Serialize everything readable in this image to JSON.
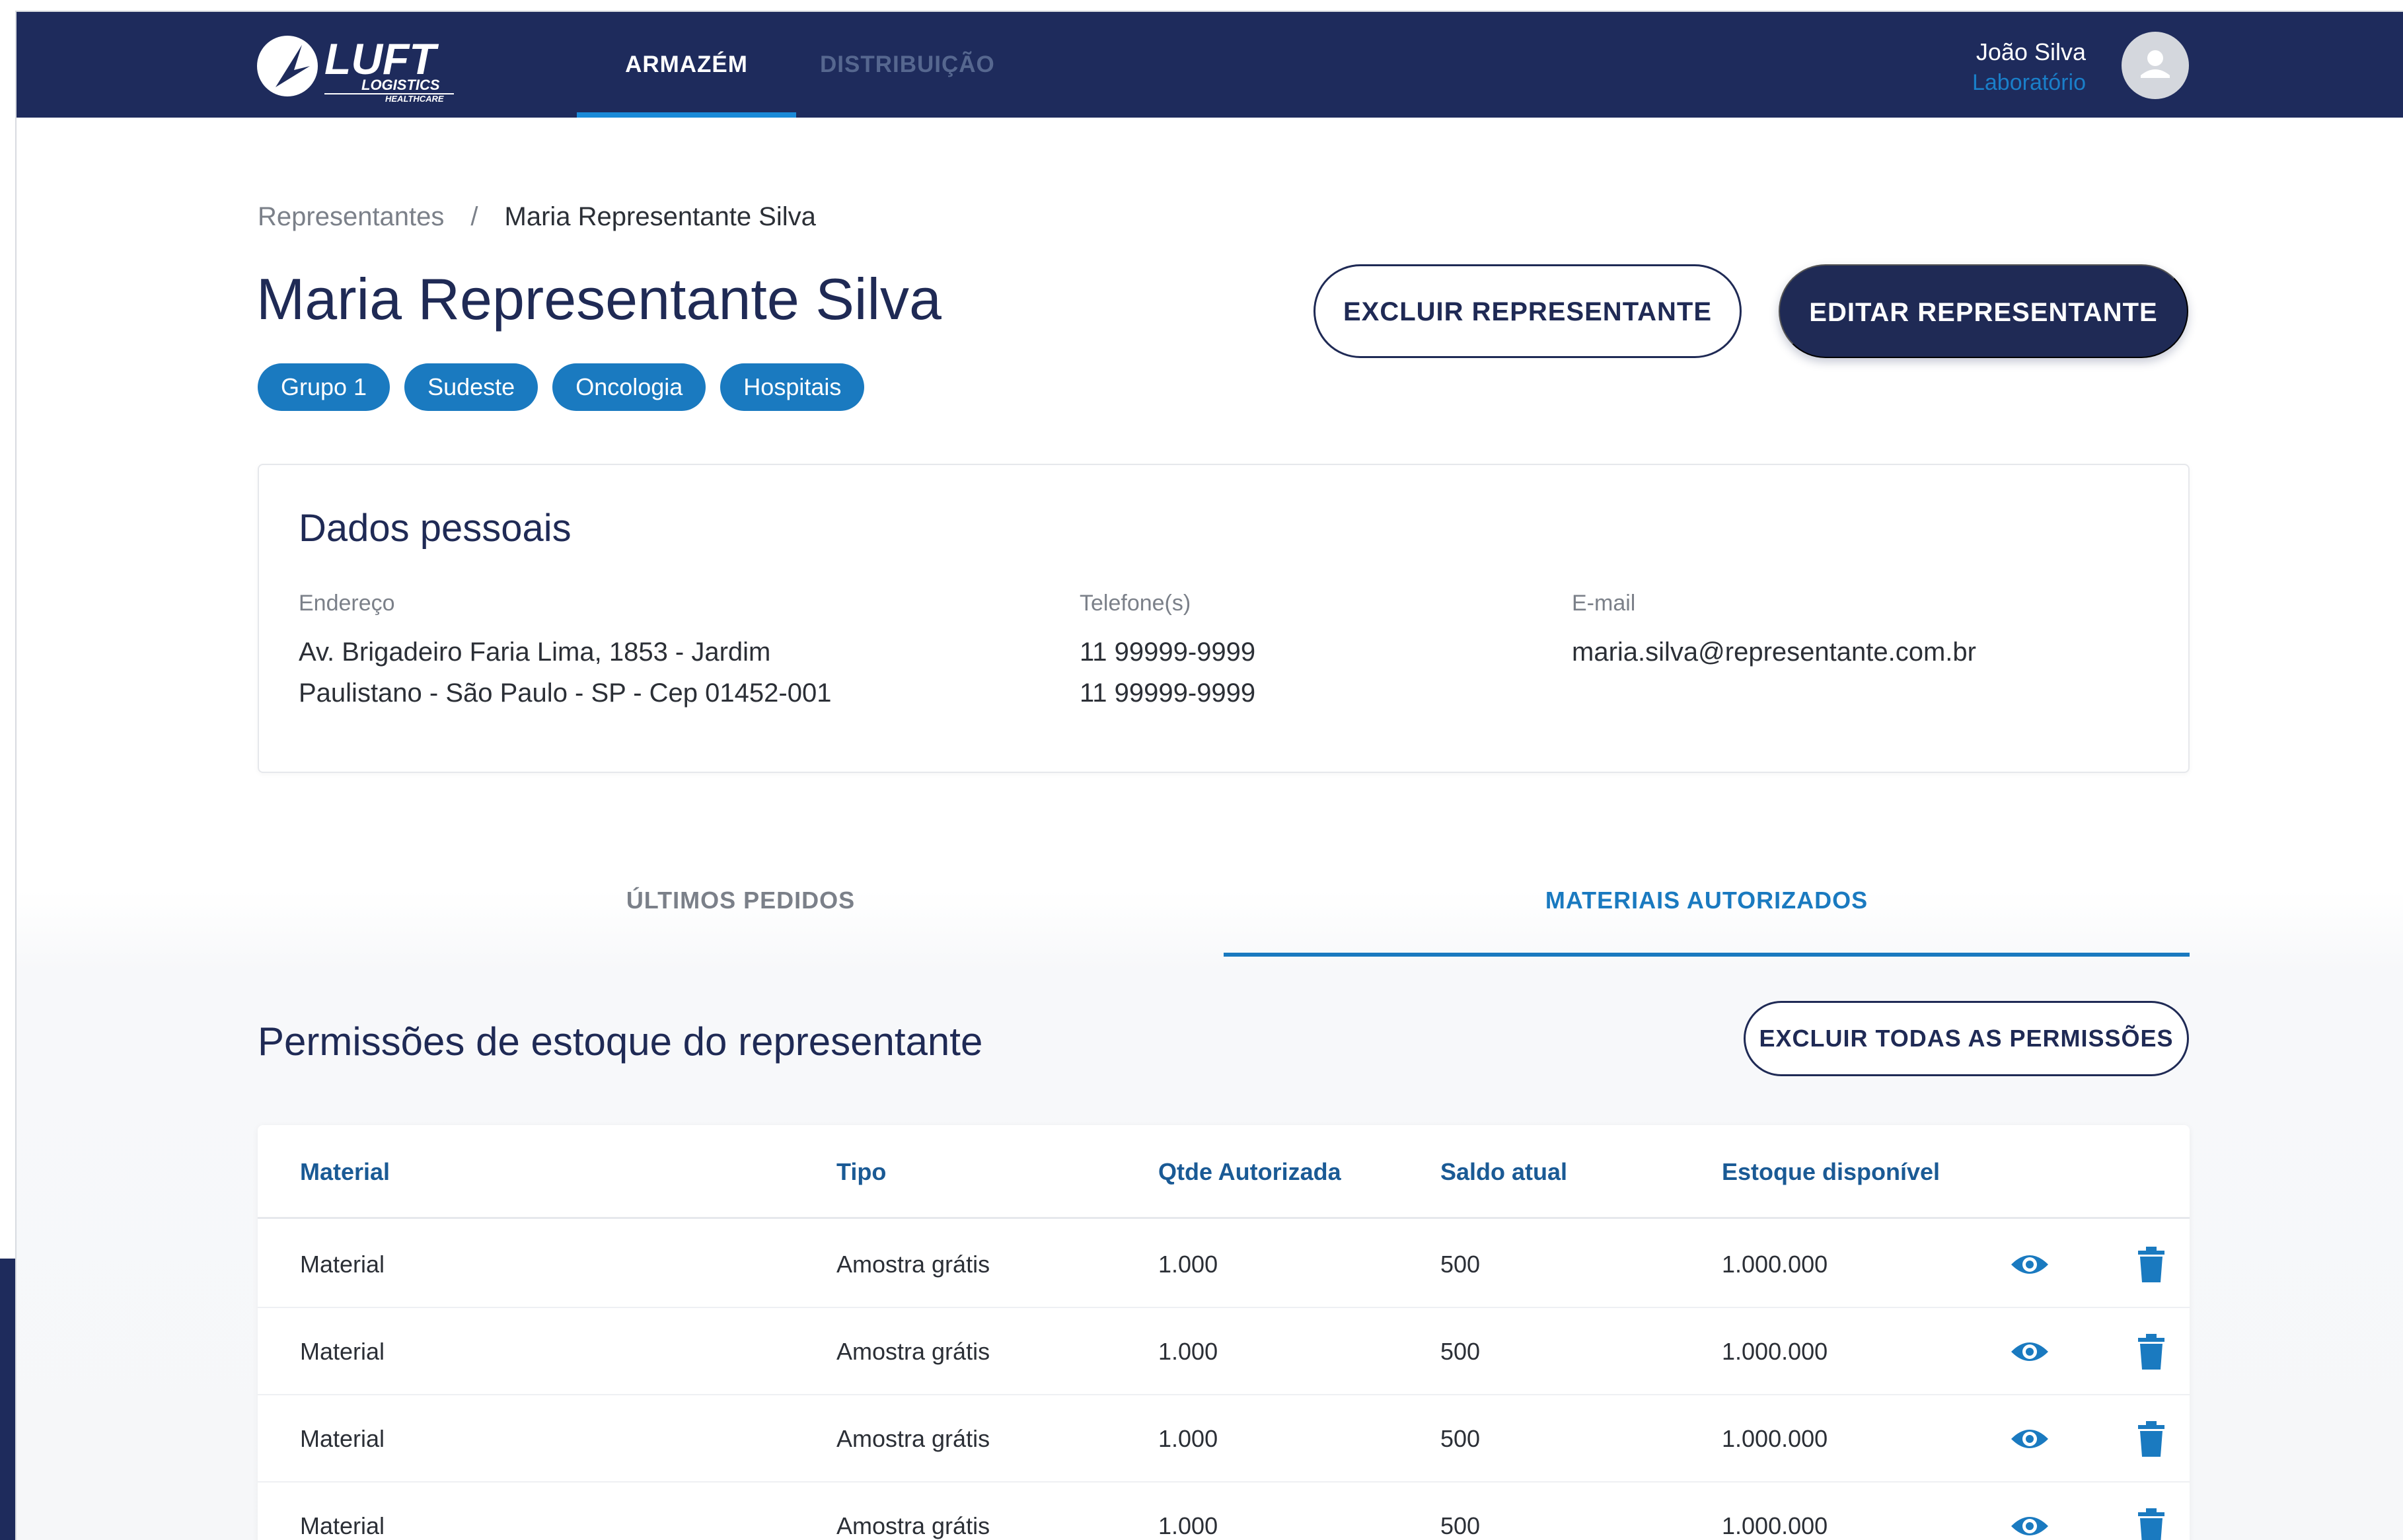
{
  "colors": {
    "navy": "#1e2b5c",
    "accent_blue": "#1a7ac0",
    "header_link_blue": "#1a5a95"
  },
  "header": {
    "logo_text": "LUFT",
    "logo_sub1": "LOGISTICS",
    "logo_sub2": "HEALTHCARE",
    "nav": [
      {
        "label": "ARMAZÉM",
        "active": true
      },
      {
        "label": "DISTRIBUIÇÃO",
        "active": false
      }
    ],
    "user": {
      "name": "João Silva",
      "role": "Laboratório",
      "avatar_icon": "user-icon"
    }
  },
  "breadcrumb": {
    "parent": "Representantes",
    "separator": "/",
    "current": "Maria Representante Silva"
  },
  "page": {
    "title": "Maria Representante Silva",
    "tags": [
      "Grupo 1",
      "Sudeste",
      "Oncologia",
      "Hospitais"
    ],
    "delete_button": "EXCLUIR REPRESENTANTE",
    "edit_button": "EDITAR REPRESENTANTE"
  },
  "personal": {
    "title": "Dados pessoais",
    "address_label": "Endereço",
    "address_line1": "Av. Brigadeiro Faria Lima, 1853 - Jardim",
    "address_line2": "Paulistano - São Paulo - SP - Cep 01452-001",
    "phone_label": "Telefone(s)",
    "phone1": "11 99999-9999",
    "phone2": "11 99999-9999",
    "email_label": "E-mail",
    "email": "maria.silva@representante.com.br"
  },
  "tabs": [
    {
      "label": "ÚLTIMOS PEDIDOS",
      "active": false
    },
    {
      "label": "MATERIAIS AUTORIZADOS",
      "active": true
    }
  ],
  "permissions": {
    "title": "Permissões de estoque do representante",
    "delete_all_button": "EXCLUIR TODAS AS PERMISSÕES",
    "columns": [
      "Material",
      "Tipo",
      "Qtde Autorizada",
      "Saldo atual",
      "Estoque disponível"
    ],
    "row_icons": [
      "eye-icon",
      "trash-icon"
    ],
    "rows": [
      [
        "Material",
        "Amostra grátis",
        "1.000",
        "500",
        "1.000.000"
      ],
      [
        "Material",
        "Amostra grátis",
        "1.000",
        "500",
        "1.000.000"
      ],
      [
        "Material",
        "Amostra grátis",
        "1.000",
        "500",
        "1.000.000"
      ],
      [
        "Material",
        "Amostra grátis",
        "1.000",
        "500",
        "1.000.000"
      ]
    ]
  }
}
